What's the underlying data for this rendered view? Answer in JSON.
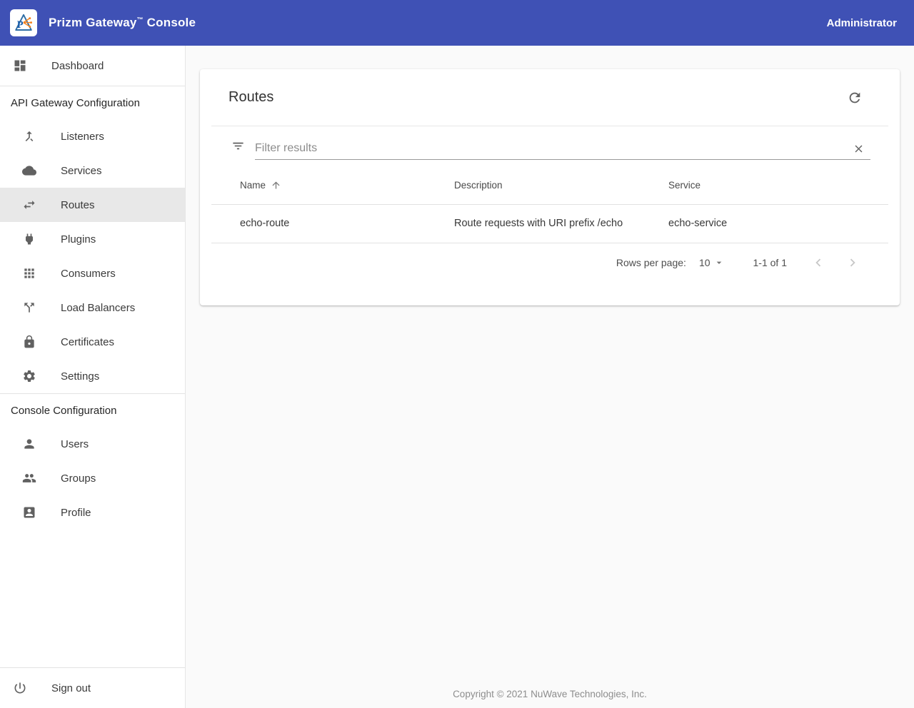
{
  "header": {
    "title_prefix": "Prizm Gateway",
    "title_tm": "™",
    "title_suffix": " Console",
    "user": "Administrator",
    "bg_color": "#3f51b5",
    "logo_icon": "prizm-prism-logo"
  },
  "sidebar": {
    "dashboard": {
      "label": "Dashboard",
      "icon": "dashboard-icon"
    },
    "sections": [
      {
        "label": "API Gateway Configuration",
        "items": [
          {
            "label": "Listeners",
            "icon": "call-merge-icon",
            "active": false
          },
          {
            "label": "Services",
            "icon": "cloud-icon",
            "active": false
          },
          {
            "label": "Routes",
            "icon": "swap-arrows-icon",
            "active": true
          },
          {
            "label": "Plugins",
            "icon": "power-plug-icon",
            "active": false
          },
          {
            "label": "Consumers",
            "icon": "apps-grid-icon",
            "active": false
          },
          {
            "label": "Load Balancers",
            "icon": "call-split-icon",
            "active": false
          },
          {
            "label": "Certificates",
            "icon": "lock-icon",
            "active": false
          },
          {
            "label": "Settings",
            "icon": "gear-icon",
            "active": false
          }
        ]
      },
      {
        "label": "Console Configuration",
        "items": [
          {
            "label": "Users",
            "icon": "person-icon",
            "active": false
          },
          {
            "label": "Groups",
            "icon": "people-icon",
            "active": false
          },
          {
            "label": "Profile",
            "icon": "account-box-icon",
            "active": false
          }
        ]
      }
    ],
    "signout": {
      "label": "Sign out",
      "icon": "power-off-icon"
    },
    "active_bg_color": "#e8e8e8"
  },
  "main": {
    "card": {
      "title": "Routes",
      "refresh_icon": "refresh-icon",
      "filter": {
        "placeholder": "Filter results",
        "clear_icon": "close-icon"
      },
      "table": {
        "columns": [
          "Name",
          "Description",
          "Service"
        ],
        "sorted_column": "Name",
        "sort_direction": "ascending",
        "rows": [
          [
            "echo-route",
            "Route requests with URI prefix /echo",
            "echo-service"
          ]
        ]
      },
      "pagination": {
        "rows_per_page_label": "Rows per page:",
        "rows_per_page_value": "10",
        "range_label": "1-1 of 1"
      }
    },
    "footer": "Copyright © 2021 NuWave Technologies, Inc."
  }
}
